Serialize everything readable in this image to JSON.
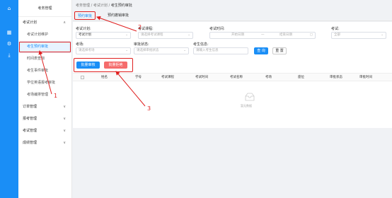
{
  "rail_icons": [
    "home-icon",
    "calendar-icon",
    "gear-icon",
    "download-icon"
  ],
  "sidebar": {
    "title": "考务管理",
    "groups": [
      {
        "label": "考试计划",
        "chevron": "∧",
        "items": [
          {
            "label": "考试计划维护",
            "active": false
          },
          {
            "label": "考生预约审批",
            "active": true
          },
          {
            "label": "时间表查询",
            "active": false
          },
          {
            "label": "考生事件审批",
            "active": false
          },
          {
            "label": "学位英语报考审批",
            "active": false
          },
          {
            "label": "考场编排管理",
            "active": false
          }
        ]
      },
      {
        "label": "订单管理",
        "chevron": "∨",
        "items": []
      },
      {
        "label": "报考管理",
        "chevron": "∨",
        "items": []
      },
      {
        "label": "考试管理",
        "chevron": "∨",
        "items": []
      },
      {
        "label": "成绩管理",
        "chevron": "∨",
        "items": []
      }
    ]
  },
  "breadcrumb": [
    "考务管理",
    "考试计划",
    "考生预约审批"
  ],
  "tabs": [
    "预约审批",
    "预约撤销审批"
  ],
  "filters": {
    "plan_label": "考试计划:",
    "plan_value": "考试计划",
    "course_label": "考试课程:",
    "course_placeholder": "请选择考试课程",
    "time_label": "考试时间:",
    "start_placeholder": "开始日期",
    "range_sep": "一",
    "end_placeholder": "结束日期",
    "status_label": "考试:",
    "status_value": "全部",
    "room_label": "考场:",
    "room_placeholder": "请选择考场",
    "approve_label": "审批状态:",
    "approve_placeholder": "请选择审批状态",
    "name_label": "考生信息:",
    "name_placeholder": "请输入考生信息",
    "query_button": "查 询",
    "reset_button": "重 置"
  },
  "actions": {
    "pass_button": "批量审核",
    "fail_button": "批量拒绝"
  },
  "table": {
    "columns": [
      "姓名",
      "学号",
      "考试课程",
      "考试时间",
      "考试名称",
      "考场",
      "座位",
      "审批状态",
      "审批时间"
    ],
    "empty_text": "暂无数据"
  },
  "annotations": [
    "1",
    "2",
    "3"
  ],
  "colors": {
    "accent": "#1a8ef6",
    "danger": "#f56c6c",
    "annotation": "#e02020"
  }
}
